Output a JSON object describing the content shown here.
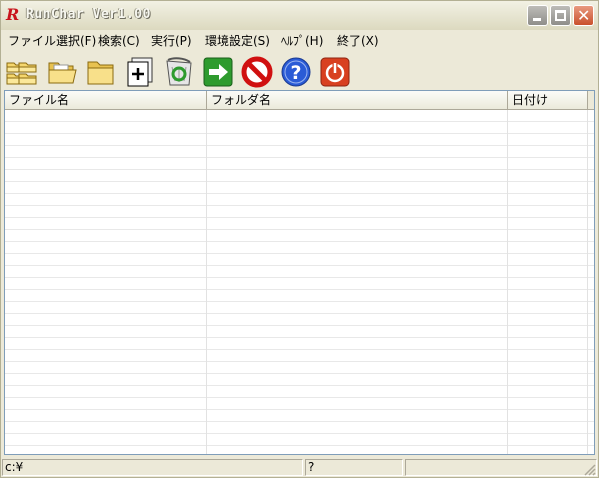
{
  "window": {
    "title": "RunChar Ver1.00",
    "app_icon_letter": "R"
  },
  "menu": [
    "ファイル選択(F)",
    "検索(C)",
    "実行(P)",
    "環境設定(S)",
    "ﾍﾙﾌﾟ(H)",
    "終了(X)"
  ],
  "toolbar": [
    {
      "name": "open-multiple-folders-icon",
      "icon": "folders"
    },
    {
      "name": "open-folder-icon",
      "icon": "folder-open"
    },
    {
      "name": "folder-icon",
      "icon": "folder"
    },
    {
      "name": "add-file-icon",
      "icon": "add"
    },
    {
      "name": "recycle-bin-icon",
      "icon": "recycle"
    },
    {
      "name": "run-arrow-icon",
      "icon": "arrow"
    },
    {
      "name": "stop-icon",
      "icon": "stop"
    },
    {
      "name": "help-icon",
      "icon": "help"
    },
    {
      "name": "power-icon",
      "icon": "power"
    }
  ],
  "list": {
    "columns": [
      "ファイル名",
      "フォルダ名",
      "日付け"
    ],
    "rows": []
  },
  "status": {
    "path": "c:¥",
    "info": "?",
    "extra": ""
  },
  "colors": {
    "title_text": "#f7f7f0",
    "close_button": "#c9502c",
    "run_green": "#2e9b2e",
    "stop_red": "#d01010",
    "help_blue": "#2a5bd6",
    "power_red": "#d84020"
  }
}
